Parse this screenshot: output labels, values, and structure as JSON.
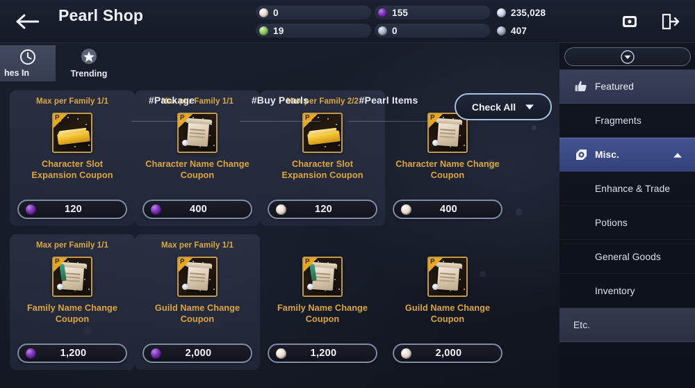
{
  "header": {
    "back_icon": "back-arrow-icon",
    "title": "Pearl Shop",
    "currencies": [
      {
        "id": "pearl-white",
        "icon": "pearl-white-icon",
        "value": "0"
      },
      {
        "id": "pearl-purple",
        "icon": "pearl-purple-icon",
        "value": "155"
      },
      {
        "id": "silver",
        "icon": "silver-coin-icon",
        "value": "235,028"
      },
      {
        "id": "loyalty",
        "icon": "green-token-icon",
        "value": "19"
      },
      {
        "id": "mileage",
        "icon": "grey-token-icon",
        "value": "0"
      },
      {
        "id": "contribution",
        "icon": "silver-token-icon",
        "value": "407"
      }
    ],
    "actions": [
      {
        "id": "mailbox",
        "icon": "mailbox-icon"
      },
      {
        "id": "exit",
        "icon": "exit-door-icon"
      }
    ]
  },
  "tabbar": {
    "timer_tab": {
      "icon": "clock-icon",
      "label": "hes In"
    },
    "trending_tab": {
      "icon": "star-icon",
      "label": "Trending"
    },
    "hash_tabs": [
      {
        "label": "#Package"
      },
      {
        "label": "#Buy Pearls"
      },
      {
        "label": "#Pearl Items"
      }
    ],
    "check_all": {
      "label": "Check All",
      "icon": "chevron-down-icon"
    }
  },
  "products": [
    {
      "max": "Max per Family 1/1",
      "name": "Character Slot\nExpansion Coupon",
      "art": "gold-bar",
      "currency": "pearl-purple",
      "price": "120"
    },
    {
      "max": "Max per Family 1/1",
      "name": "Character Name Change\nCoupon",
      "art": "scroll",
      "currency": "pearl-purple",
      "price": "400"
    },
    {
      "max": "Max per Family 2/2",
      "name": "Character Slot\nExpansion Coupon",
      "art": "gold-bar",
      "currency": "pearl-white",
      "price": "120"
    },
    {
      "max": "",
      "name": "Character Name Change\nCoupon",
      "art": "scroll",
      "currency": "pearl-white",
      "price": "400"
    },
    {
      "max": "Max per Family 1/1",
      "name": "Family Name Change\nCoupon",
      "art": "scroll-ribbon",
      "currency": "pearl-purple",
      "price": "1,200"
    },
    {
      "max": "Max per Family 1/1",
      "name": "Guild Name Change\nCoupon",
      "art": "scroll",
      "currency": "pearl-purple",
      "price": "2,000"
    },
    {
      "max": "",
      "name": "Family Name Change\nCoupon",
      "art": "scroll-ribbon",
      "currency": "pearl-white",
      "price": "1,200"
    },
    {
      "max": "",
      "name": "Guild Name Change\nCoupon",
      "art": "scroll",
      "currency": "pearl-white",
      "price": "2,000"
    }
  ],
  "sidebar": {
    "toggle_icon": "chevron-down-icon",
    "items": [
      {
        "label": "Featured",
        "icon": "thumbs-up-icon",
        "state": "featured"
      },
      {
        "label": "Fragments",
        "icon": "",
        "state": "indent"
      },
      {
        "label": "Misc.",
        "icon": "misc-icon",
        "state": "active",
        "chevron": "chevron-up-icon"
      },
      {
        "label": "Enhance & Trade",
        "icon": "",
        "state": "indent"
      },
      {
        "label": "Potions",
        "icon": "",
        "state": "indent"
      },
      {
        "label": "General Goods",
        "icon": "",
        "state": "indent"
      },
      {
        "label": "Inventory",
        "icon": "",
        "state": "indent"
      },
      {
        "label": "Etc.",
        "icon": "",
        "state": "etc"
      }
    ]
  },
  "colors": {
    "accent_gold": "#dca63a",
    "accent_blue": "#41548f",
    "border_blue": "#a9c0e0",
    "bg_dark": "#141925"
  }
}
